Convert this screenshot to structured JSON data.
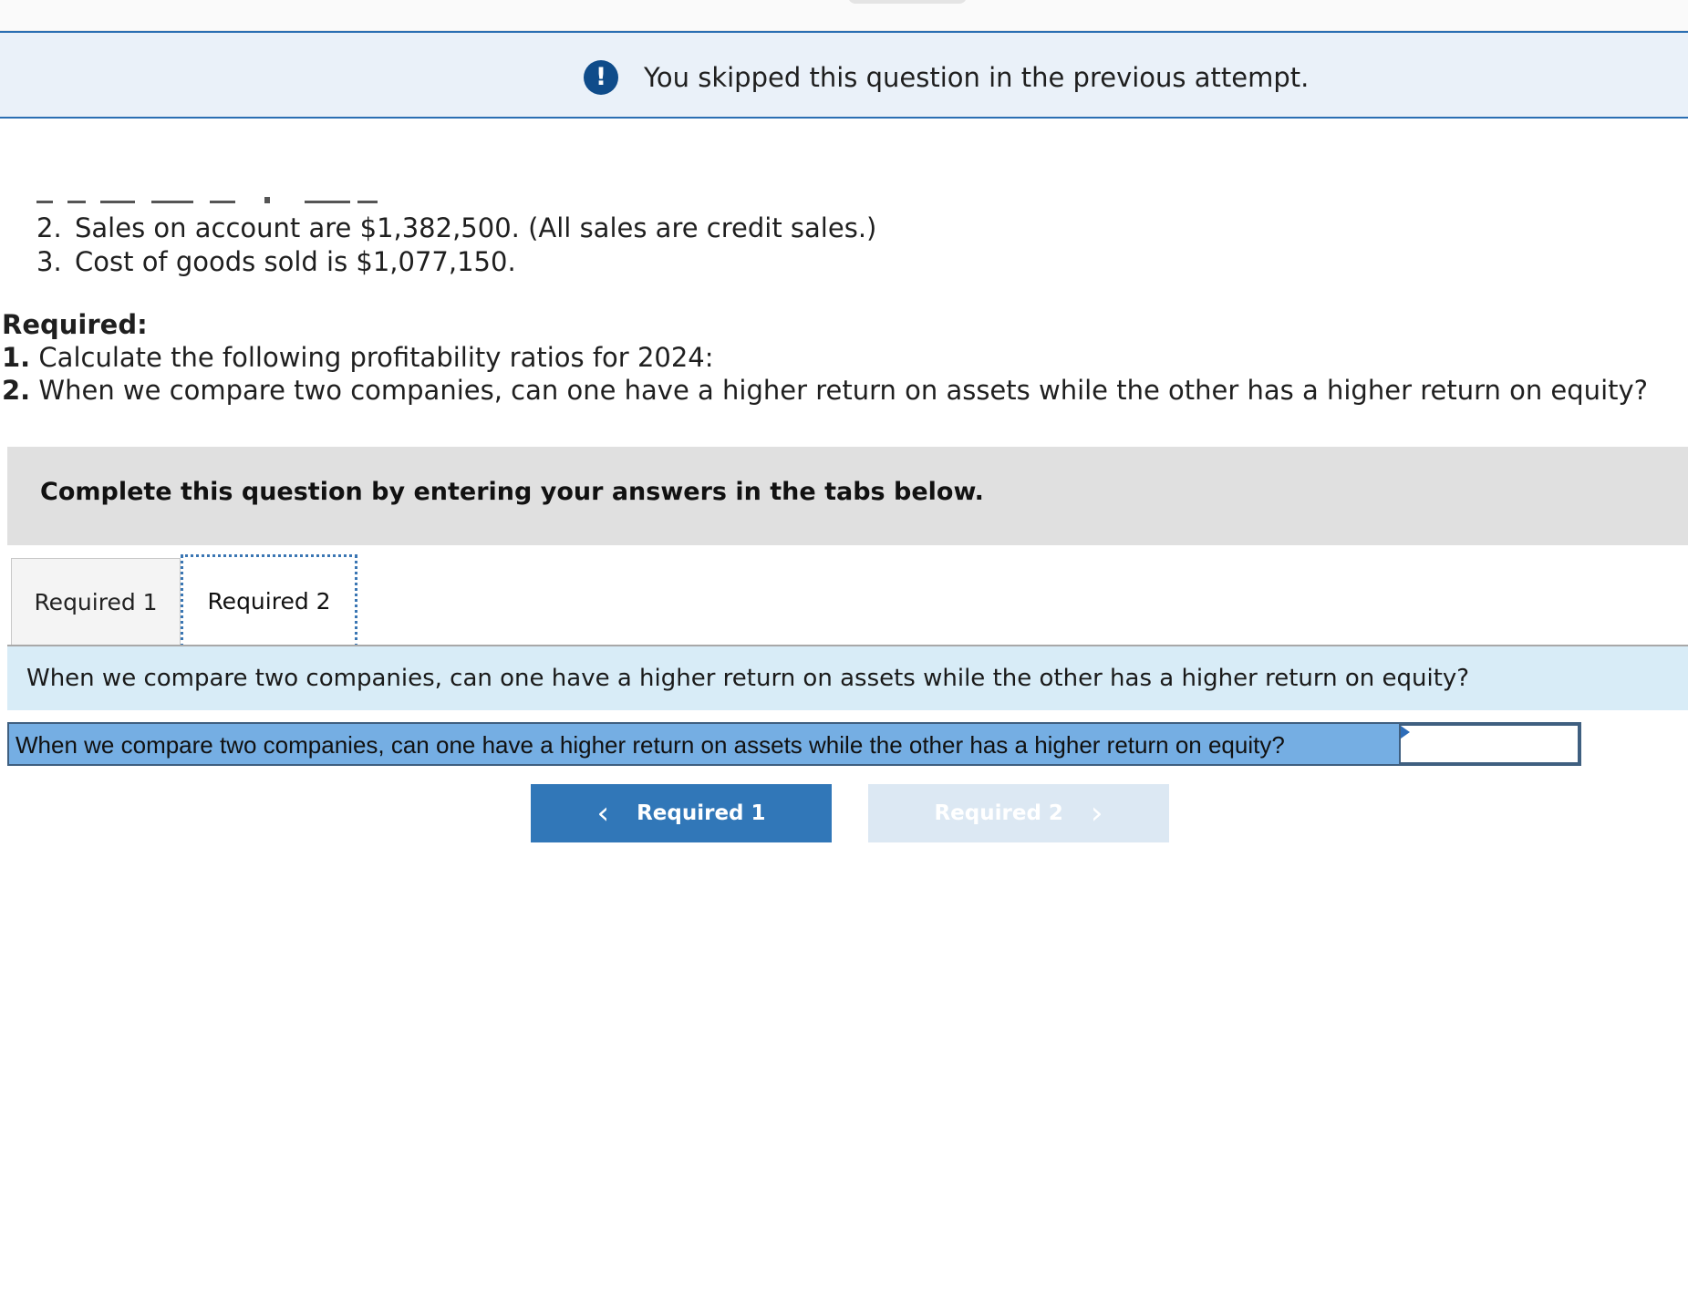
{
  "banner": {
    "message": "You skipped this question in the previous attempt."
  },
  "facts": [
    {
      "num": "2.",
      "text": "Sales on account are $1,382,500. (All sales are credit sales.)"
    },
    {
      "num": "3.",
      "text": "Cost of goods sold is $1,077,150."
    }
  ],
  "required": {
    "heading": "Required:",
    "items": [
      {
        "num": "1.",
        "text": "Calculate the following profitability ratios for 2024:"
      },
      {
        "num": "2.",
        "text": "When we compare two companies, can one have a higher return on assets while the other has a higher return on equity?"
      }
    ]
  },
  "instructions": "Complete this question by entering your answers in the tabs below.",
  "tabs": [
    {
      "label": "Required 1"
    },
    {
      "label": "Required 2"
    }
  ],
  "active_tab": "Required 2",
  "question": "When we compare two companies, can one have a higher return on assets while the other has a higher return on equity?",
  "answer_row": {
    "label": "When we compare two companies, can one have a higher return on assets while the other has a higher return on equity?",
    "value": ""
  },
  "nav": {
    "prev_label": "Required 1",
    "next_label": "Required 2"
  },
  "colors": {
    "banner_bg": "#eaf1f9",
    "banner_border": "#2b6fb3",
    "alert_icon": "#0f4c8a",
    "question_bar": "#d8ecf7",
    "answer_row": "#75aee3",
    "nav_prev": "#3177b8",
    "nav_next_disabled": "#dce8f3"
  }
}
